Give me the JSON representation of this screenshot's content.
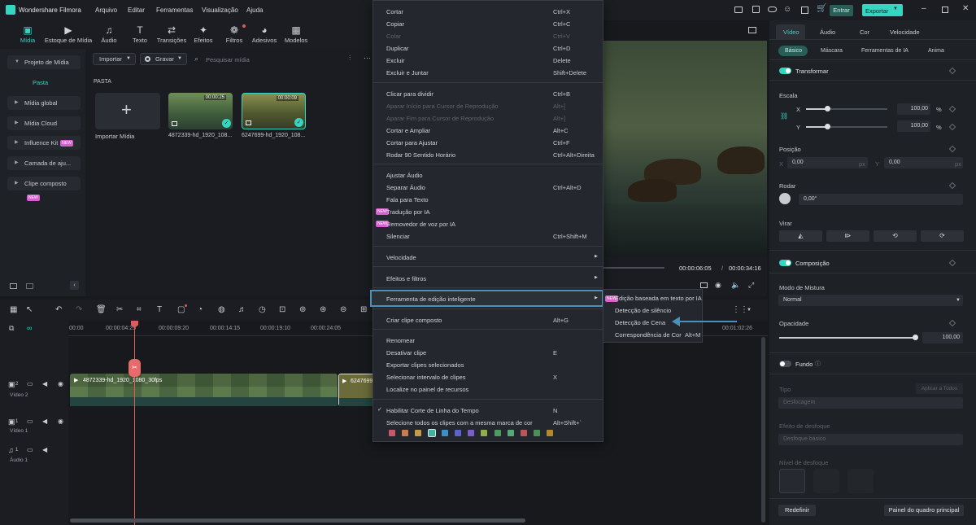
{
  "app": {
    "title": "Wondershare Filmora"
  },
  "menubar": [
    "Arquivo",
    "Editar",
    "Ferramentas",
    "Visualização",
    "Ajuda"
  ],
  "titlebar_right": {
    "login_label": "Entrar",
    "export_label": "Exportar"
  },
  "toolbar": {
    "tools": [
      {
        "label": "Mídia",
        "icon": "media-icon",
        "active": true
      },
      {
        "label": "Estoque de Mídia",
        "icon": "stock-media-icon"
      },
      {
        "label": "Áudio",
        "icon": "music-icon"
      },
      {
        "label": "Texto",
        "icon": "text-icon"
      },
      {
        "label": "Transições",
        "icon": "transitions-icon"
      },
      {
        "label": "Efeitos",
        "icon": "effects-icon"
      },
      {
        "label": "Filtros",
        "icon": "filters-icon"
      },
      {
        "label": "Adesivos",
        "icon": "stickers-icon"
      },
      {
        "label": "Modelos",
        "icon": "templates-icon"
      }
    ]
  },
  "left_panel": {
    "project_media": "Projeto de Mídia",
    "folder": "Pasta",
    "items": [
      "Mídia global",
      "Mídia Cloud",
      "Influence Kit",
      "Camada de aju...",
      "Clipe composto"
    ],
    "badge": "NEW"
  },
  "media_panel": {
    "import_label": "Importar",
    "record_label": "Gravar",
    "search_placeholder": "Pesquisar mídia",
    "section_title": "PASTA",
    "import_media_label": "Importar Mídia",
    "clips": [
      {
        "name": "4872339-hd_1920_108...",
        "duration": "00:00:25"
      },
      {
        "name": "6247699-hd_1920_108...",
        "duration": "00:00:09"
      }
    ]
  },
  "preview": {
    "current_time": "00:00:06:05",
    "separator": "/",
    "total_time": "00:00:34:16"
  },
  "right_panel": {
    "tabs": [
      "Vídeo",
      "Áudio",
      "Cor",
      "Velocidade"
    ],
    "subtabs": [
      "Básico",
      "Máscara",
      "Ferramentas de IA",
      "Anima"
    ],
    "transform_label": "Transformar",
    "scale_label": "Escala",
    "x_label": "X",
    "y_label": "Y",
    "scale_x_value": "100,00",
    "scale_y_value": "100,00",
    "percent": "%",
    "position_label": "Posição",
    "pos_x": "0,00",
    "pos_y": "0,00",
    "px": "px",
    "rotate_label": "Rodar",
    "rotate_value": "0,00°",
    "flip_label": "Virar",
    "composition_label": "Composição",
    "blend_label": "Modo de Mistura",
    "blend_value": "Normal",
    "opacity_label": "Opacidade",
    "opacity_value": "100,00",
    "opacity_fraction": 1.0,
    "background_label": "Fundo",
    "type_label": "Tipo",
    "apply_all_label": "Aplicar a Todos",
    "type_value": "Desfocagem",
    "blur_effect_label": "Efeito de desfoque",
    "blur_effect_value": "Desfoque básico",
    "blur_level_label": "Nível de desfoque",
    "reset_label": "Redefinir",
    "keyframe_panel_label": "Painel do quadro principal"
  },
  "timeline": {
    "ruler": [
      "00:00",
      "00:00:04:25",
      "00:00:09:20",
      "00:00:14:15",
      "00:00:19:10",
      "00:00:24:05",
      "00:01:02:26"
    ],
    "tracks": [
      {
        "label": "Vídeo 2",
        "number": "2"
      },
      {
        "label": "Vídeo 1",
        "number": "1"
      },
      {
        "label": "Áudio 1",
        "number": "1"
      }
    ],
    "clip_labels": [
      "4872339-hd_1920_1080_30fps",
      "6247699-hd"
    ]
  },
  "context_menu": {
    "items": [
      {
        "label": "Cortar",
        "shortcut": "Ctrl+X"
      },
      {
        "label": "Copiar",
        "shortcut": "Ctrl+C"
      },
      {
        "label": "Colar",
        "shortcut": "Ctrl+V",
        "disabled": true
      },
      {
        "label": "Duplicar",
        "shortcut": "Ctrl+D"
      },
      {
        "label": "Excluir",
        "shortcut": "Delete"
      },
      {
        "label": "Excluir e Juntar",
        "shortcut": "Shift+Delete"
      },
      {
        "label": "Clicar para dividir",
        "shortcut": "Ctrl+B"
      },
      {
        "label": "Aparar Início para Cursor de Reprodução",
        "shortcut": "Alt+[",
        "disabled": true
      },
      {
        "label": "Aparar Fim para Cursor de Reprodução",
        "shortcut": "Alt+]",
        "disabled": true
      },
      {
        "label": "Cortar e Ampliar",
        "shortcut": "Alt+C"
      },
      {
        "label": "Cortar para Ajustar",
        "shortcut": "Ctrl+F"
      },
      {
        "label": "Rodar 90 Sentido Horário",
        "shortcut": "Ctrl+Alt+Direita"
      },
      {
        "label": "Ajustar Áudio",
        "shortcut": ""
      },
      {
        "label": "Separar Áudio",
        "shortcut": "Ctrl+Alt+D"
      },
      {
        "label": "Fala para Texto",
        "shortcut": ""
      },
      {
        "label": "Tradução por IA",
        "shortcut": ""
      },
      {
        "label": "Removedor de voz por IA",
        "shortcut": ""
      },
      {
        "label": "Silenciar",
        "shortcut": "Ctrl+Shift+M"
      },
      {
        "label": "Velocidade",
        "shortcut": ""
      },
      {
        "label": "Efeitos e filtros",
        "shortcut": ""
      },
      {
        "label": "Ferramenta de edição inteligente",
        "shortcut": ""
      },
      {
        "label": "Criar clipe composto",
        "shortcut": "Alt+G"
      },
      {
        "label": "Renomear",
        "shortcut": ""
      },
      {
        "label": "Desativar clipe",
        "shortcut": "E"
      },
      {
        "label": "Exportar clipes selecionados",
        "shortcut": ""
      },
      {
        "label": "Selecionar intervalo de clipes",
        "shortcut": "X"
      },
      {
        "label": "Localize no painel de recursos",
        "shortcut": ""
      },
      {
        "label": "Habilitar Corte de Linha do Tempo",
        "shortcut": "N"
      },
      {
        "label": "Selecione todos os clipes com a mesma marca de cor",
        "shortcut": "Alt+Shift+`"
      }
    ],
    "color_marks": [
      "#c7586c",
      "#c57e4f",
      "#c59a4a",
      "#3fb3a0",
      "#3d8fc8",
      "#5b63c8",
      "#7a5fc8",
      "#8fae4c",
      "#4f9a61",
      "#57a779",
      "#b7565d",
      "#4e8f59",
      "#b2892c"
    ]
  },
  "submenu": {
    "items": [
      {
        "label": "Edição baseada em texto por IA",
        "shortcut": ""
      },
      {
        "label": "Detecção de silêncio",
        "shortcut": ""
      },
      {
        "label": "Detecção de Cena",
        "shortcut": ""
      },
      {
        "label": "Correspondência de Cor",
        "shortcut": "Alt+M"
      }
    ]
  },
  "colors": {
    "accent": "#36d5c2",
    "playhead": "#e25b5b",
    "highlight_border": "#4a90b8"
  }
}
